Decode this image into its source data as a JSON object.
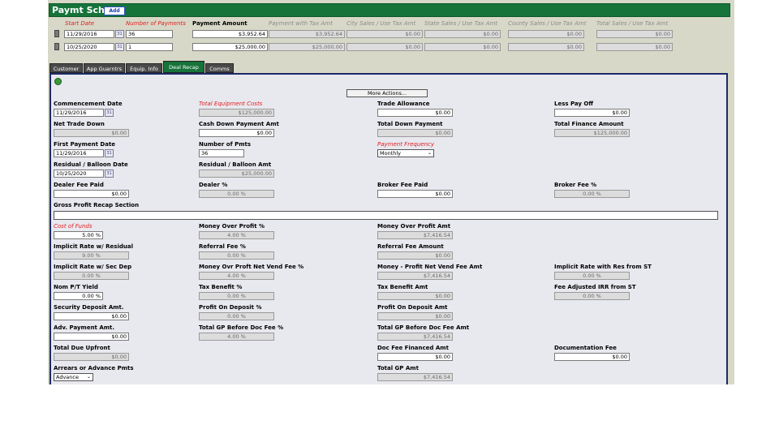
{
  "header": {
    "title": "Paymt Schd",
    "add_label": "Add"
  },
  "columns": {
    "start_date": "Start Date",
    "num_payments": "Number of Payments",
    "payment_amount": "Payment Amount",
    "payment_tax": "Payment with Tax Amt",
    "city_tax": "City Sales / Use Tax Amt",
    "state_tax": "State Sales / Use Tax Amt",
    "county_tax": "County Sales / Use Tax Amt",
    "total_tax": "Total Sales / Use Tax Amt"
  },
  "rows": [
    {
      "start": "11/29/2016",
      "num": "36",
      "amount": "$3,952.64",
      "with_tax": "$3,952.64",
      "city": "$0.00",
      "state": "$0.00",
      "county": "$0.00",
      "total": "$0.00"
    },
    {
      "start": "10/25/2020",
      "num": "1",
      "amount": "$25,000.00",
      "with_tax": "$25,000.00",
      "city": "$0.00",
      "state": "$0.00",
      "county": "$0.00",
      "total": "$0.00"
    }
  ],
  "tabs": [
    "Customer",
    "App Guarntrs",
    "Equip. Info",
    "Deal Recap",
    "Comms"
  ],
  "more_actions": "More Actions...",
  "fields": {
    "commencement_date": {
      "label": "Commencement Date",
      "value": "11/29/2016"
    },
    "total_equipment_costs": {
      "label": "Total Equipment Costs",
      "value": "$125,000.00"
    },
    "trade_allowance": {
      "label": "Trade Allowance",
      "value": "$0.00"
    },
    "less_pay_off": {
      "label": "Less Pay Off",
      "value": "$0.00"
    },
    "net_trade_down": {
      "label": "Net Trade Down",
      "value": "$0.00"
    },
    "cash_down": {
      "label": "Cash Down Payment Amt",
      "value": "$0.00"
    },
    "total_down": {
      "label": "Total Down Payment",
      "value": "$0.00"
    },
    "total_finance": {
      "label": "Total Finance Amount",
      "value": "$125,000.00"
    },
    "first_payment_date": {
      "label": "First Payment Date",
      "value": "11/29/2016"
    },
    "number_of_pmts": {
      "label": "Number of Pmts",
      "value": "36"
    },
    "payment_frequency": {
      "label": "Payment Frequency",
      "value": "Monthly"
    },
    "residual_date": {
      "label": "Residual / Balloon Date",
      "value": "10/25/2020"
    },
    "residual_amt": {
      "label": "Residual / Balloon Amt",
      "value": "$25,000.00"
    },
    "dealer_fee_paid": {
      "label": "Dealer Fee Paid",
      "value": "$0.00"
    },
    "dealer_pct": {
      "label": "Dealer %",
      "value": "0.00 %"
    },
    "broker_fee_paid": {
      "label": "Broker Fee Paid",
      "value": "$0.00"
    },
    "broker_fee_pct": {
      "label": "Broker Fee %",
      "value": "0.00 %"
    },
    "gross_profit_section": {
      "label": "Gross Profit Recap Section"
    },
    "cost_of_funds": {
      "label": "Cost of Funds",
      "value": "5.00 %"
    },
    "money_over_profit_pct": {
      "label": "Money Over Profit %",
      "value": "4.00 %"
    },
    "money_over_profit_amt": {
      "label": "Money Over Profit Amt",
      "value": "$7,416.54"
    },
    "implicit_rate_residual": {
      "label": "Implicit Rate w/ Residual",
      "value": "9.00 %"
    },
    "referral_fee_pct": {
      "label": "Referral Fee %",
      "value": "0.00 %"
    },
    "referral_fee_amt": {
      "label": "Referral Fee Amount",
      "value": "$0.00"
    },
    "implicit_rate_secdep": {
      "label": "Implicit Rate w/ Sec Dep",
      "value": "0.00 %"
    },
    "money_ovr_vend_pct": {
      "label": "Money Ovr Proft Net Vend Fee %",
      "value": "4.00 %"
    },
    "money_profit_vend_amt": {
      "label": "Money - Profit Net Vend Fee Amt",
      "value": "$7,416.54"
    },
    "implicit_rate_res_st": {
      "label": "Implicit Rate with Res from ST",
      "value": "0.00 %"
    },
    "nom_pt_yield": {
      "label": "Nom P/T Yield",
      "value": "0.00 %"
    },
    "tax_benefit_pct": {
      "label": "Tax Benefit %",
      "value": "0.00 %"
    },
    "tax_benefit_amt": {
      "label": "Tax Benefit Amt",
      "value": "$0.00"
    },
    "fee_adjusted_irr": {
      "label": "Fee Adjusted IRR from ST",
      "value": "0.00 %"
    },
    "security_deposit": {
      "label": "Security Deposit Amt.",
      "value": "$0.00"
    },
    "profit_on_deposit_pct": {
      "label": "Profit On Deposit %",
      "value": "0.00 %"
    },
    "profit_on_deposit_amt": {
      "label": "Profit On Deposit Amt",
      "value": "$0.00"
    },
    "adv_payment": {
      "label": "Adv. Payment Amt.",
      "value": "$0.00"
    },
    "total_gp_before_pct": {
      "label": "Total GP Before Doc Fee %",
      "value": "4.00 %"
    },
    "total_gp_before_amt": {
      "label": "Total GP Before Doc Fee Amt",
      "value": "$7,416.54"
    },
    "total_due_upfront": {
      "label": "Total Due Upfront",
      "value": "$0.00"
    },
    "doc_fee_financed": {
      "label": "Doc Fee Financed Amt",
      "value": "$0.00"
    },
    "documentation_fee": {
      "label": "Documentation Fee",
      "value": "$0.00"
    },
    "arrears_advance": {
      "label": "Arrears or Advance Pmts",
      "value": "Advance"
    },
    "total_gp_amt": {
      "label": "Total GP Amt",
      "value": "$7,416.54"
    }
  }
}
